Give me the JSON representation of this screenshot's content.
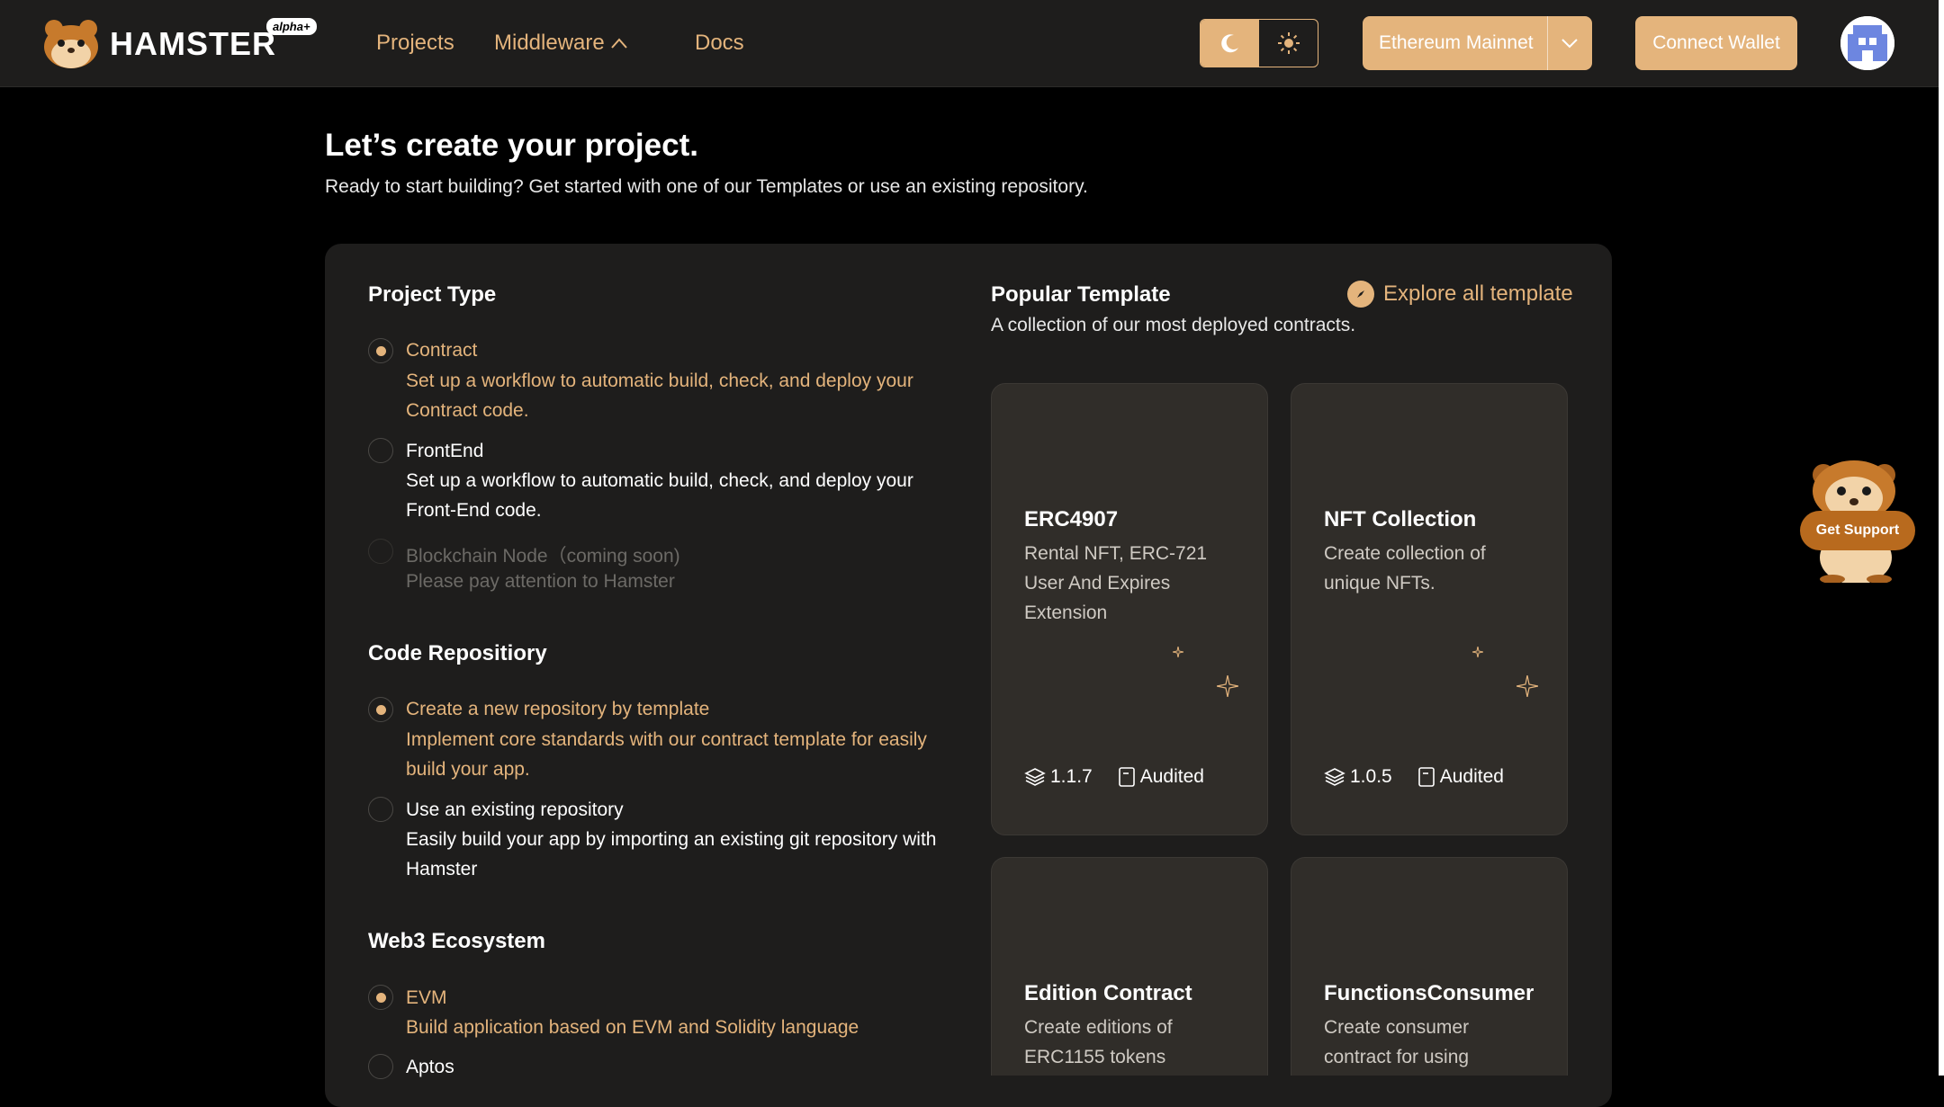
{
  "header": {
    "logo_text": "HAMSTER",
    "alpha_badge": "alpha",
    "nav": [
      "Projects",
      "Middleware",
      "Docs"
    ],
    "network": "Ethereum Mainnet",
    "connect_label": "Connect Wallet"
  },
  "page": {
    "title": "Let’s create your project.",
    "subtitle": "Ready to start building? Get started with one of our Templates or use an existing repository."
  },
  "project_type": {
    "title": "Project Type",
    "options": [
      {
        "label": "Contract",
        "desc": "Set up a workflow to automatic build, check, and deploy your Contract code.",
        "state": "selected"
      },
      {
        "label": "FrontEnd",
        "desc": "Set up a workflow to automatic build, check, and deploy your Front-End code.",
        "state": "normal"
      },
      {
        "label": "Blockchain Node（coming soon)",
        "desc": "Please pay attention to Hamster",
        "state": "disabled"
      }
    ]
  },
  "code_repo": {
    "title": "Code Repositiory",
    "options": [
      {
        "label": "Create a new repository by template",
        "desc": "Implement core standards with our contract template for easily build your app.",
        "state": "selected"
      },
      {
        "label": "Use an existing repository",
        "desc": "Easily build your app by importing an existing git repository with Hamster",
        "state": "normal"
      }
    ]
  },
  "ecosystem": {
    "title": "Web3 Ecosystem",
    "options": [
      {
        "label": "EVM",
        "desc": "Build application based on EVM and Solidity language",
        "state": "selected"
      },
      {
        "label": "Aptos",
        "state": "normal"
      }
    ]
  },
  "templates": {
    "title": "Popular Template",
    "subtitle": "A collection of our most deployed contracts.",
    "explore_label": "Explore all template",
    "cards": [
      {
        "name": "ERC4907",
        "desc": "Rental NFT, ERC-721 User And Expires Extension",
        "version": "1.1.7",
        "status": "Audited"
      },
      {
        "name": "NFT Collection",
        "desc": "Create collection of unique NFTs.",
        "version": "1.0.5",
        "status": "Audited"
      },
      {
        "name": "Edition Contract",
        "desc": "Create editions of ERC1155 tokens"
      },
      {
        "name": "FunctionsConsumer",
        "desc": "Create consumer contract for using"
      }
    ]
  },
  "support": {
    "label": "Get Support"
  },
  "colors": {
    "accent": "#e4b47c",
    "panel": "#1e1d1c",
    "card": "#302d29",
    "background": "#000000"
  }
}
